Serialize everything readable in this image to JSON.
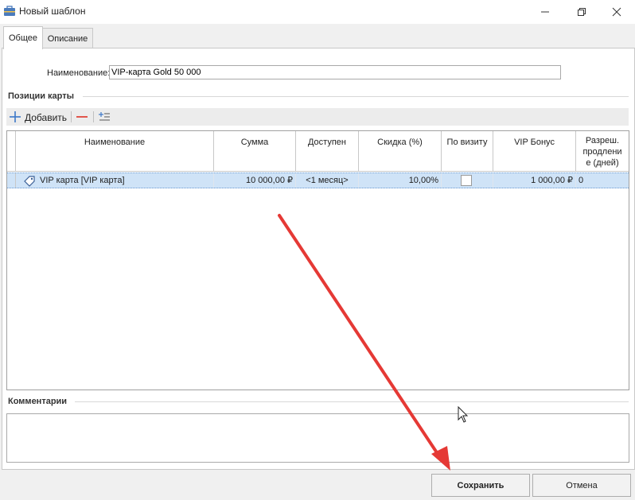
{
  "window": {
    "title": "Новый шаблон",
    "icons": [
      "briefcase-icon",
      "minimize-icon",
      "restore-icon",
      "close-icon"
    ]
  },
  "tabs": [
    {
      "label": "Общее",
      "active": true
    },
    {
      "label": "Описание",
      "active": false
    }
  ],
  "form": {
    "name_label": "Наименование:",
    "name_value": "VIP-карта Gold 50 000"
  },
  "positions": {
    "title": "Позиции карты",
    "add_label": "Добавить",
    "columns": [
      "Наименование",
      "Сумма",
      "Доступен",
      "Скидка (%)",
      "По визиту",
      "VIP Бонус",
      "Разреш. продлени е (дней)"
    ],
    "rows": [
      {
        "name": "VIP карта [VIP карта]",
        "sum": "10 000,00 ₽",
        "available": "<1 месяц>",
        "discount": "10,00%",
        "per_visit": false,
        "vip_bonus": "1 000,00 ₽",
        "extension": "0"
      }
    ]
  },
  "comments": {
    "title": "Комментарии"
  },
  "buttons": {
    "save": "Сохранить",
    "cancel": "Отмена"
  },
  "colors": {
    "selection": "#cfe3f7",
    "annotation_arrow": "#e53935",
    "remove_icon": "#e0453a",
    "add_icon": "#3c78c8"
  }
}
